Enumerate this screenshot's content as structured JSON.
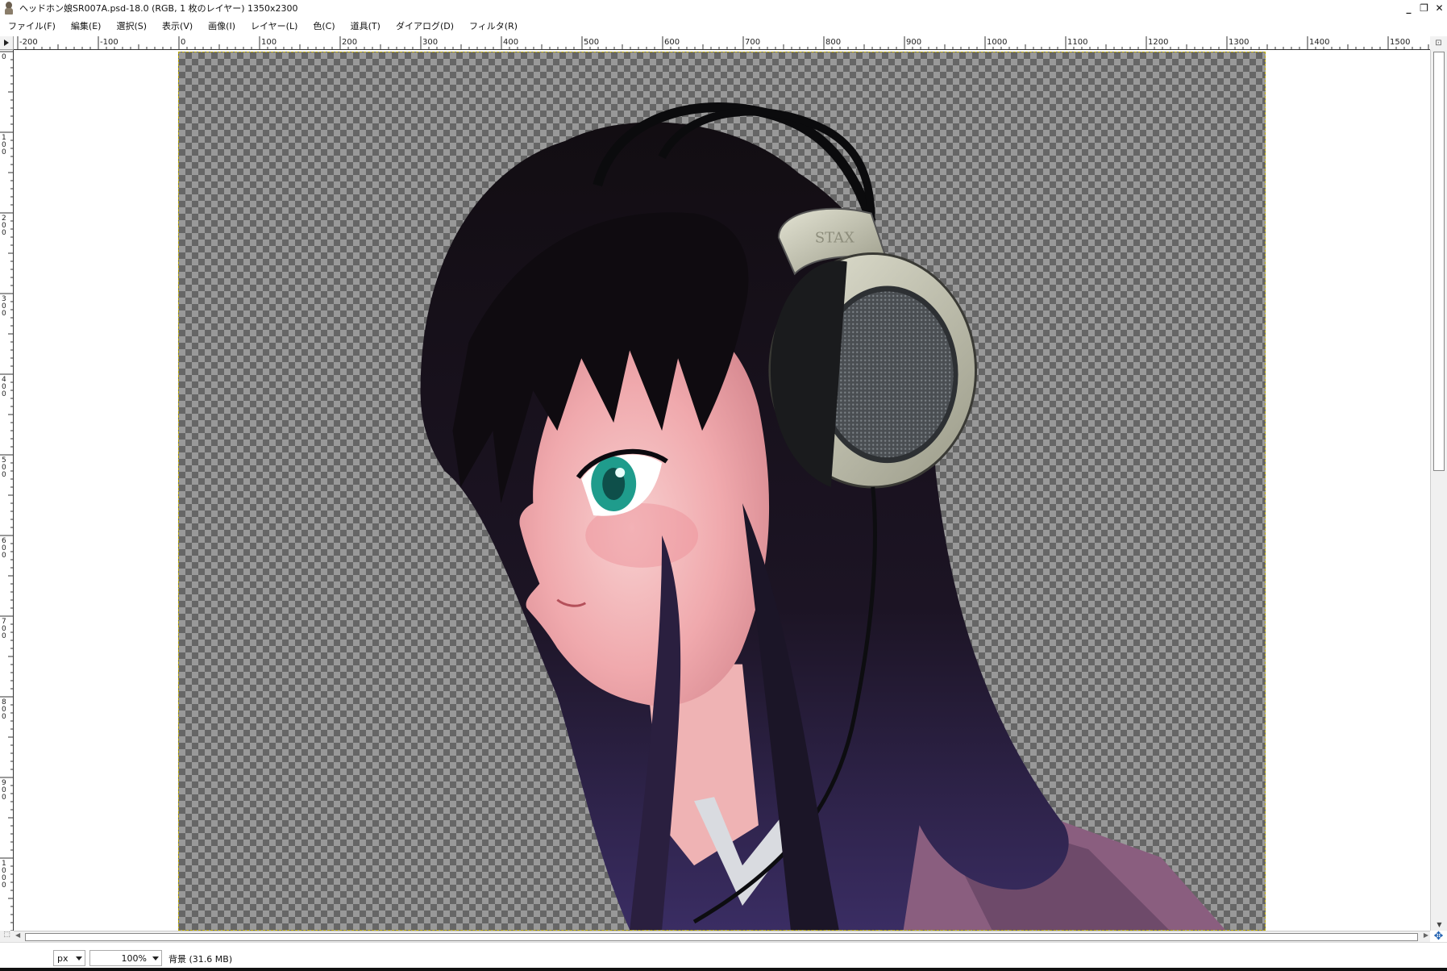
{
  "window": {
    "title": "ヘッドホン娘SR007A.psd-18.0 (RGB, 1 枚のレイヤー) 1350x2300",
    "minimize_label": "_",
    "restore_label": "❐",
    "close_label": "✕"
  },
  "menu": {
    "items": [
      {
        "label": "ファイル(F)"
      },
      {
        "label": "編集(E)"
      },
      {
        "label": "選択(S)"
      },
      {
        "label": "表示(V)"
      },
      {
        "label": "画像(I)"
      },
      {
        "label": "レイヤー(L)"
      },
      {
        "label": "色(C)"
      },
      {
        "label": "道具(T)"
      },
      {
        "label": "ダイアログ(D)"
      },
      {
        "label": "フィルタ(R)"
      }
    ]
  },
  "ruler": {
    "horizontal_labels": [
      "-200",
      "-100",
      "0",
      "100",
      "200",
      "300",
      "400",
      "500",
      "600",
      "700",
      "800",
      "900",
      "1000",
      "1100",
      "1200",
      "1300",
      "1400",
      "1500"
    ],
    "vertical_labels": [
      "0",
      "100",
      "200",
      "300",
      "400",
      "500",
      "600",
      "700",
      "800",
      "900",
      "1000"
    ]
  },
  "status": {
    "unit": "px",
    "zoom": "100%",
    "layer_info": "背景 (31.6 MB)"
  },
  "icons": {
    "app": "gimp-wilber-icon",
    "corner": "ruler-corner-icon",
    "navigate": "navigate-cross-icon",
    "quick_mask": "quick-mask-icon",
    "zoom_fit": "zoom-fit-icon"
  },
  "artwork": {
    "headphone_brand": "STAX"
  }
}
